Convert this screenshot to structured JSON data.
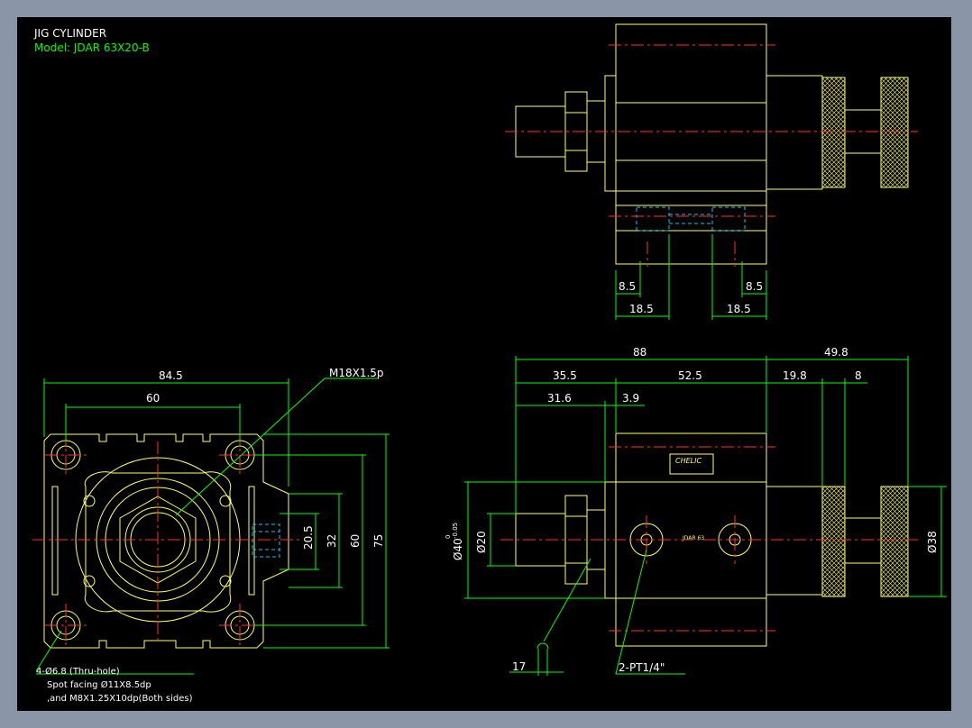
{
  "title_block": {
    "title": "JIG CYLINDER",
    "model": "Model: JDAR 63X20-B"
  },
  "colors": {
    "background": "#000000",
    "frame": "#8a96a8",
    "outline": "#ffff66",
    "dimension": "#00ff00",
    "centerline": "#ff3030",
    "hidden": "#00ccff",
    "text": "#ffffff"
  },
  "front_view": {
    "dim_overall_width": "84.5",
    "dim_hole_pitch_h": "60",
    "dim_port_depth": "20.5",
    "dim_hole_pitch_v": "32",
    "dim_body_inner": "60",
    "dim_overall_height": "75",
    "thread_note": "M18X1.5p",
    "hole_note_1": "4-Ø6.8 (Thru-hole)",
    "hole_note_2": "Spot facing  Ø11X8.5dp",
    "hole_note_3": ",and M8X1.25X10dp(Both sides)"
  },
  "top_view": {
    "dim_left_inner": "8.5",
    "dim_right_inner": "8.5",
    "dim_left_outer": "18.5",
    "dim_right_outer": "18.5"
  },
  "side_view": {
    "dim_total": "88",
    "dim_knob": "49.8",
    "dim_rod_ext": "35.5",
    "dim_body": "52.5",
    "dim_knob_body": "19.8",
    "dim_knob_gap": "8",
    "dim_rod": "31.6",
    "dim_nut": "3.9",
    "dim_rod_dia": "Ø20",
    "dim_boss_dia": "Ø40",
    "dim_boss_tol_upper": "0",
    "dim_boss_tol_lower": "-0.05",
    "dim_knob_dia": "Ø38",
    "dim_wrench": "17",
    "port_note": "2-PT1/4\"",
    "label_brand": "CHELIC",
    "label_small": "JDAR 63"
  }
}
